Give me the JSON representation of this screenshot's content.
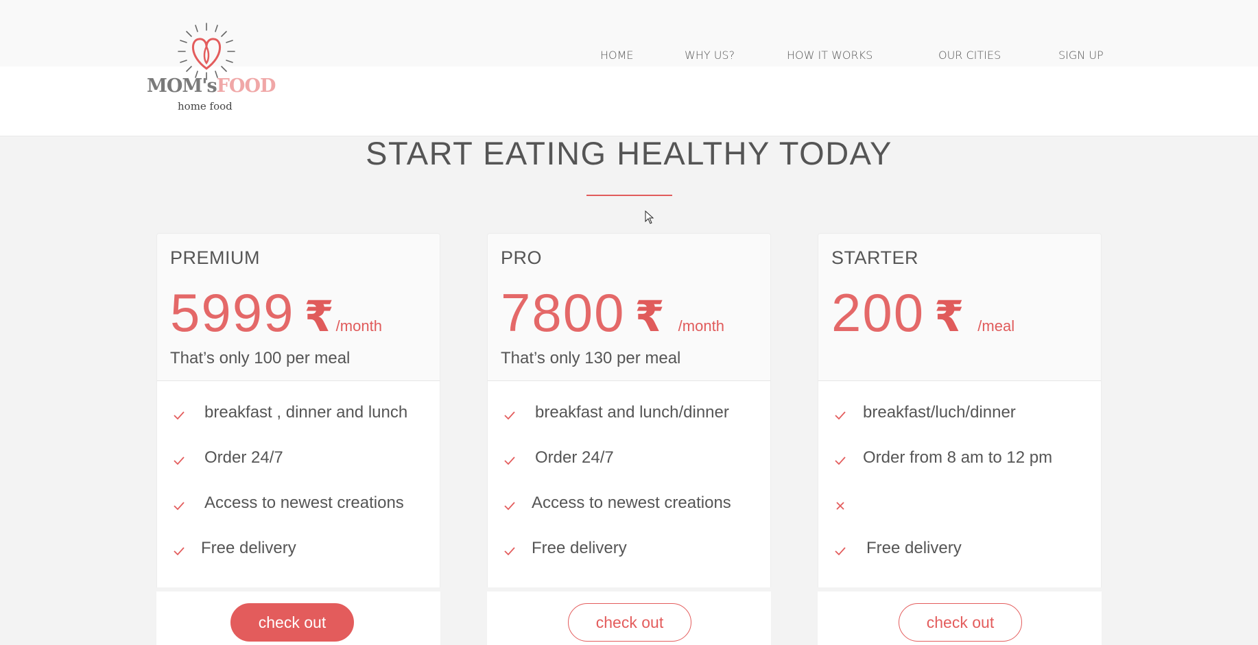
{
  "header": {
    "logo": {
      "brand_moms": "MOM's",
      "brand_food": "FOOD",
      "tagline": "home food"
    },
    "nav": [
      {
        "label": "HOME"
      },
      {
        "label": "WHY US?"
      },
      {
        "label": "HOW IT WORKS"
      },
      {
        "label": "OUR CITIES"
      },
      {
        "label": "SIGN UP"
      }
    ]
  },
  "section": {
    "title": "START EATING HEALTHY TODAY"
  },
  "colors": {
    "accent": "#e35c5c",
    "text": "#555555",
    "background": "#f3f3f3"
  },
  "plans": [
    {
      "name": "PREMIUM",
      "price": "5999",
      "currency": "₹",
      "period": "/month",
      "subtext": "That’s only 100 per meal",
      "features": [
        {
          "icon": "check-icon",
          "text": "breakfast , dinner and lunch"
        },
        {
          "icon": "check-icon",
          "text": "Order 24/7"
        },
        {
          "icon": "check-icon",
          "text": "Access to newest creations"
        },
        {
          "icon": "check-icon",
          "text": "Free delivery"
        }
      ],
      "button": "check out"
    },
    {
      "name": "PRO",
      "price": "7800",
      "currency": "₹",
      "period": "/month",
      "subtext": "That’s only 130 per meal",
      "features": [
        {
          "icon": "check-icon",
          "text": "breakfast and lunch/dinner"
        },
        {
          "icon": "check-icon",
          "text": "Order 24/7"
        },
        {
          "icon": "check-icon",
          "text": "Access to newest creations"
        },
        {
          "icon": "check-icon",
          "text": "Free delivery"
        }
      ],
      "button": "check out"
    },
    {
      "name": "STARTER",
      "price": "200",
      "currency": "₹",
      "period": "/meal",
      "subtext": "",
      "features": [
        {
          "icon": "check-icon",
          "text": "breakfast/luch/dinner"
        },
        {
          "icon": "check-icon",
          "text": "Order from 8 am to 12 pm"
        },
        {
          "icon": "cross-icon",
          "text": ""
        },
        {
          "icon": "check-icon",
          "text": "Free delivery"
        }
      ],
      "button": "check out"
    }
  ]
}
